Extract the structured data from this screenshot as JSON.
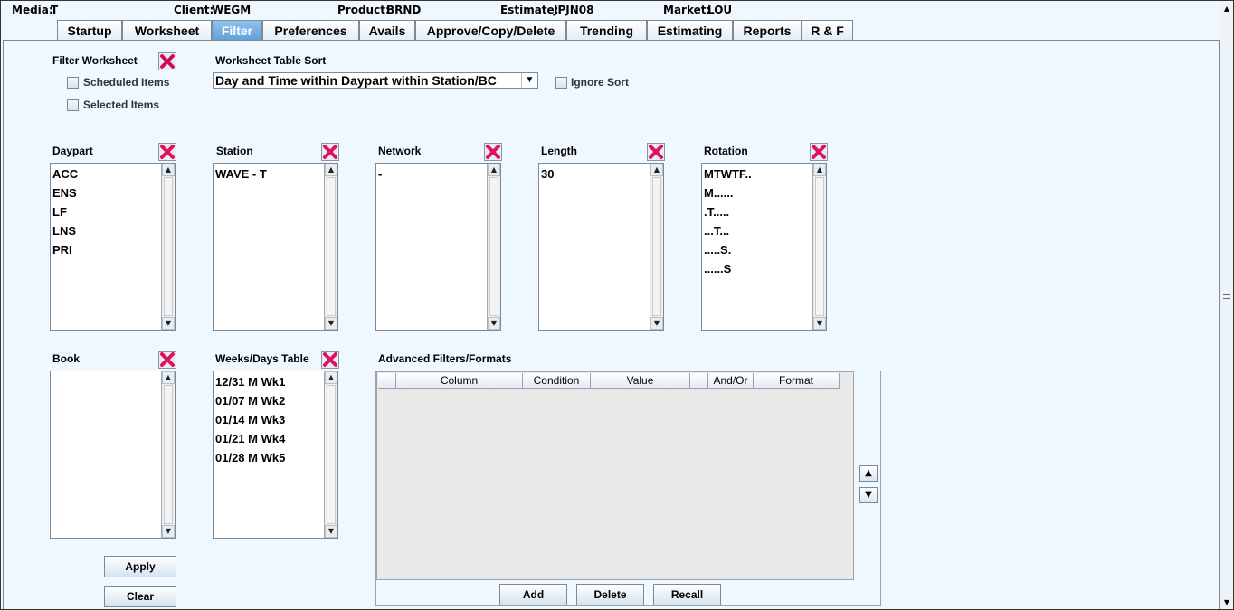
{
  "header": {
    "media_label": "Media:",
    "media_value": "T",
    "client_label": "Client:",
    "client_value": "WEGM",
    "product_label": "Product:",
    "product_value": "BRND",
    "estimate_label": "Estimate:",
    "estimate_value": "JPJN08",
    "market_label": "Market:",
    "market_value": "LOU"
  },
  "tabs": [
    "Startup",
    "Worksheet",
    "Filter",
    "Preferences",
    "Avails",
    "Approve/Copy/Delete",
    "Trending",
    "Estimating",
    "Reports",
    "R & F"
  ],
  "active_tab": "Filter",
  "filter_worksheet": {
    "label": "Filter Worksheet",
    "scheduled_items": "Scheduled Items",
    "selected_items": "Selected Items"
  },
  "sort": {
    "label": "Worksheet Table Sort",
    "value": "Day and Time within Daypart within Station/BC",
    "ignore_label": "Ignore Sort"
  },
  "lists": {
    "daypart": {
      "label": "Daypart",
      "items": [
        "ACC",
        "ENS",
        "LF",
        "LNS",
        "PRI"
      ]
    },
    "station": {
      "label": "Station",
      "items": [
        "WAVE  - T"
      ]
    },
    "network": {
      "label": "Network",
      "items": [
        "-"
      ]
    },
    "length": {
      "label": "Length",
      "items": [
        "30"
      ]
    },
    "rotation": {
      "label": "Rotation",
      "items": [
        "MTWTF..",
        "M......",
        ".T.....",
        "...T...",
        ".....S.",
        "......S"
      ]
    },
    "book": {
      "label": "Book",
      "items": []
    },
    "weeks": {
      "label": "Weeks/Days Table",
      "items": [
        "12/31 M Wk1",
        "01/07 M Wk2",
        "01/14 M Wk3",
        "01/21 M Wk4",
        "01/28 M Wk5"
      ]
    }
  },
  "advanced": {
    "label": "Advanced Filters/Formats",
    "columns": [
      "",
      "Column",
      "Condition",
      "Value",
      "",
      "And/Or",
      "Format"
    ],
    "add": "Add",
    "delete": "Delete",
    "recall": "Recall"
  },
  "buttons": {
    "apply": "Apply",
    "clear": "Clear"
  },
  "colors": {
    "active_tab": "#6aa8e0",
    "background": "#f0f8ff",
    "clear_x": "#e0115f"
  }
}
